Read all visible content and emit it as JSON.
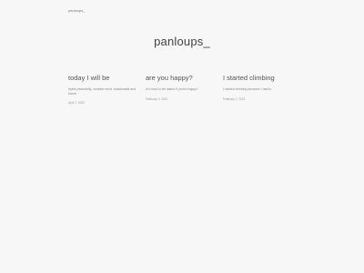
{
  "nav": {
    "home_link": "panloups_"
  },
  "header": {
    "title": "panloups_"
  },
  "posts": [
    {
      "title": "today I will be",
      "excerpt": "tiptoe peacefully, creative mind, sustainable and future",
      "date": "April 7, 2022"
    },
    {
      "title": "are you happy?",
      "excerpt": "is it hard to be asked if you're happy?",
      "date": "February 3, 2022"
    },
    {
      "title": "I started climbing",
      "excerpt": "I started climbing because I had to",
      "date": "February 2, 2022"
    }
  ]
}
